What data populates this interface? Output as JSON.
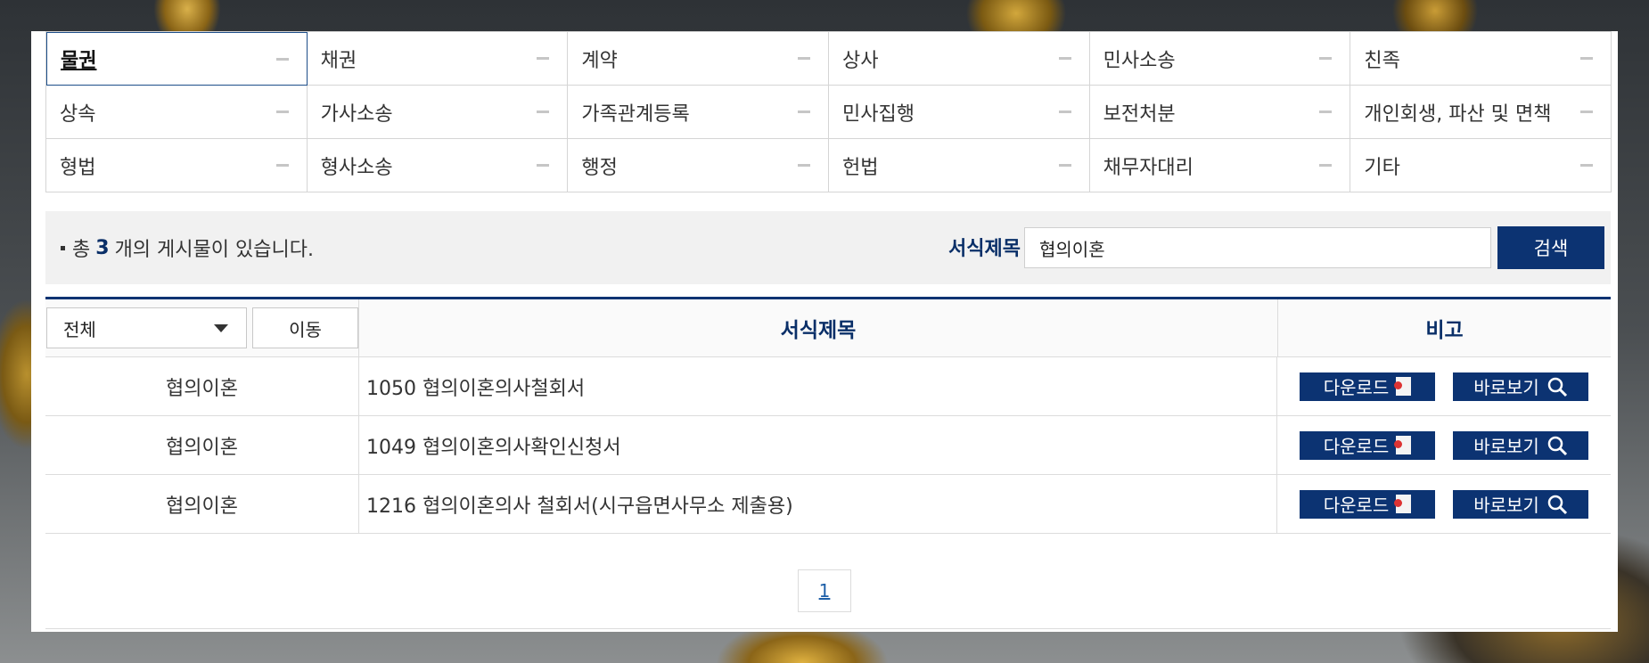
{
  "categories": [
    {
      "label": "물권",
      "active": true
    },
    {
      "label": "채권"
    },
    {
      "label": "계약"
    },
    {
      "label": "상사"
    },
    {
      "label": "민사소송"
    },
    {
      "label": "친족"
    },
    {
      "label": "상속"
    },
    {
      "label": "가사소송"
    },
    {
      "label": "가족관계등록"
    },
    {
      "label": "민사집행"
    },
    {
      "label": "보전처분"
    },
    {
      "label": "개인회생, 파산 및 면책"
    },
    {
      "label": "형법"
    },
    {
      "label": "형사소송"
    },
    {
      "label": "행정"
    },
    {
      "label": "헌법"
    },
    {
      "label": "채무자대리"
    },
    {
      "label": "기타"
    }
  ],
  "summary": {
    "prefix": "총",
    "count": "3",
    "suffix": "개의 게시물이 있습니다.",
    "search_label": "서식제목",
    "search_value": "협의이혼",
    "search_button": "검색"
  },
  "table": {
    "filter_value": "전체",
    "move_button": "이동",
    "col_title": "서식제목",
    "col_note": "비고",
    "rows": [
      {
        "category": "협의이혼",
        "title": "1050 협의이혼의사철회서"
      },
      {
        "category": "협의이혼",
        "title": "1049 협의이혼의사확인신청서"
      },
      {
        "category": "협의이혼",
        "title": "1216 협의이혼의사 철회서(시구읍면사무소 제출용)"
      }
    ],
    "download_label": "다운로드",
    "view_label": "바로보기"
  },
  "pagination": {
    "current": "1"
  },
  "colors": {
    "accent": "#0c3372",
    "heading": "#0a2f68",
    "link": "#1d5fa8"
  },
  "icons": {
    "download": "document-icon",
    "view": "magnifier-icon",
    "select": "caret-down-icon"
  }
}
